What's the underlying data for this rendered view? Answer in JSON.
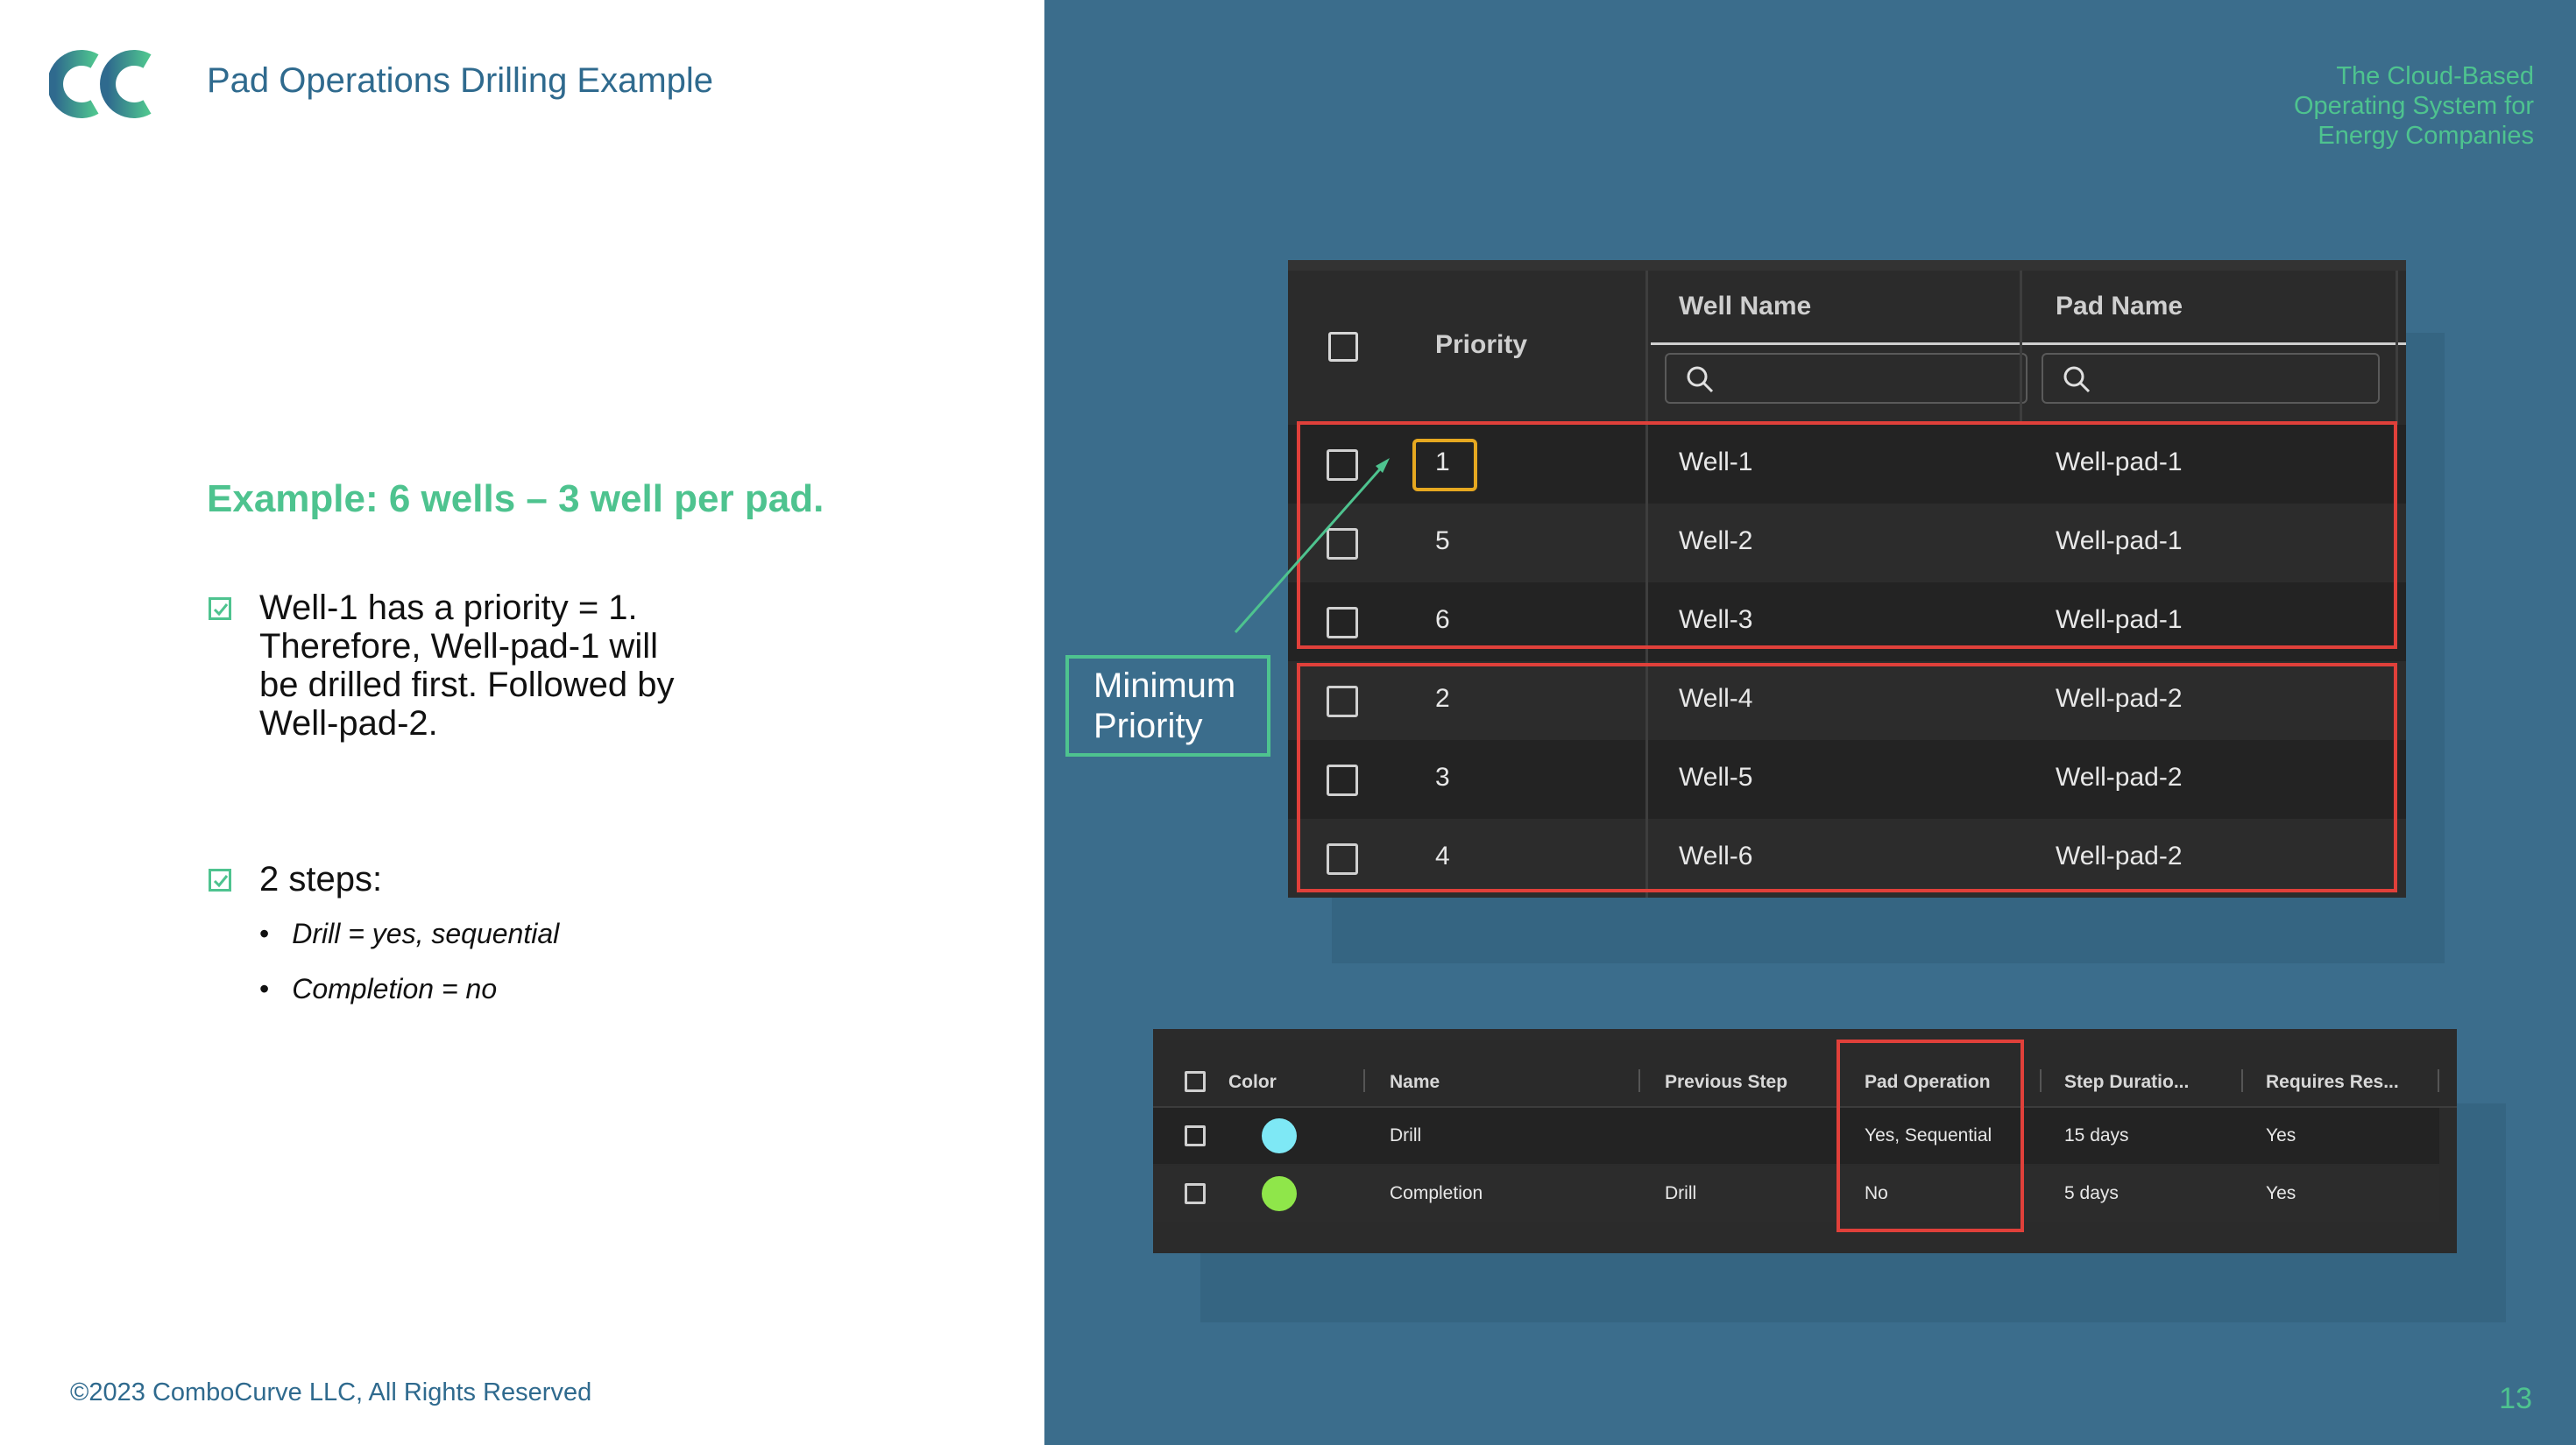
{
  "header": {
    "title": "Pad Operations Drilling Example",
    "tagline": "The Cloud-Based\nOperating System for\nEnergy Companies"
  },
  "footer": {
    "copyright": "©2023 ComboCurve LLC, All Rights Reserved",
    "page_number": "13"
  },
  "content": {
    "heading": "Example: 6 wells – 3 well per pad.",
    "bullet1": "Well-1 has a priority = 1.\nTherefore, Well-pad-1 will\nbe drilled first. Followed by\nWell-pad-2.",
    "bullet2": "2 steps:",
    "sub1": "Drill = yes, sequential",
    "sub2": "Completion = no"
  },
  "callout": {
    "label": "Minimum\nPriority"
  },
  "wells_table": {
    "headers": {
      "priority": "Priority",
      "well_name": "Well Name",
      "pad_name": "Pad Name"
    },
    "rows": [
      {
        "priority": "1",
        "well": "Well-1",
        "pad": "Well-pad-1"
      },
      {
        "priority": "5",
        "well": "Well-2",
        "pad": "Well-pad-1"
      },
      {
        "priority": "6",
        "well": "Well-3",
        "pad": "Well-pad-1"
      },
      {
        "priority": "2",
        "well": "Well-4",
        "pad": "Well-pad-2"
      },
      {
        "priority": "3",
        "well": "Well-5",
        "pad": "Well-pad-2"
      },
      {
        "priority": "4",
        "well": "Well-6",
        "pad": "Well-pad-2"
      }
    ]
  },
  "steps_table": {
    "headers": {
      "color": "Color",
      "name": "Name",
      "previous": "Previous Step",
      "pad_op": "Pad Operation",
      "duration": "Step Duratio...",
      "requires": "Requires Res..."
    },
    "rows": [
      {
        "color": "#7ee8f5",
        "name": "Drill",
        "previous": "",
        "pad_op": "Yes, Sequential",
        "duration": "15 days",
        "requires": "Yes"
      },
      {
        "color": "#8fe64a",
        "name": "Completion",
        "previous": "Drill",
        "pad_op": "No",
        "duration": "5 days",
        "requires": "Yes"
      }
    ]
  },
  "colors": {
    "accent": "#4ec38f",
    "navy": "#2f6a8e",
    "panel": "#3b6d8c",
    "highlight_red": "#e0403a",
    "highlight_yellow": "#e6a820"
  }
}
